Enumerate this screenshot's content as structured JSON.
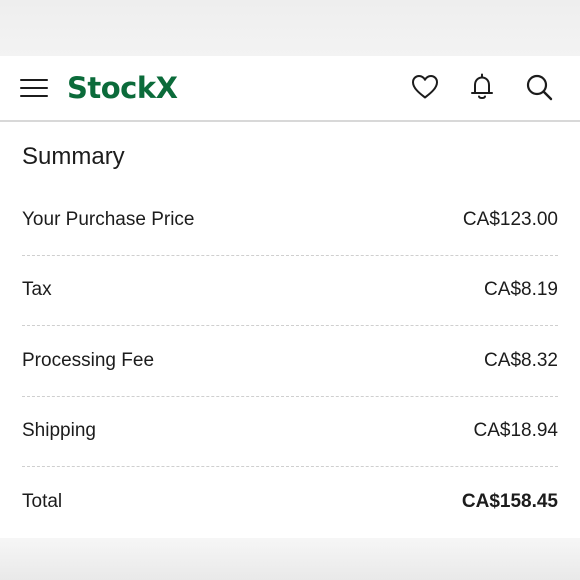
{
  "header": {
    "menu_icon": "hamburger-menu-icon",
    "brand": "StockX",
    "brand_color": "#0b6b3a",
    "icons": [
      "heart-icon",
      "bell-icon",
      "search-icon"
    ]
  },
  "summary": {
    "title": "Summary",
    "rows": [
      {
        "label": "Your Purchase Price",
        "value": "CA$123.00"
      },
      {
        "label": "Tax",
        "value": "CA$8.19"
      },
      {
        "label": "Processing Fee",
        "value": "CA$8.32"
      },
      {
        "label": "Shipping",
        "value": "CA$18.94"
      }
    ],
    "total": {
      "label": "Total",
      "value": "CA$158.45"
    }
  }
}
